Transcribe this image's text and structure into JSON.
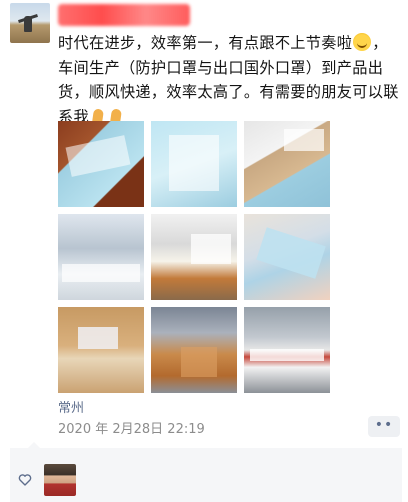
{
  "post": {
    "text_parts": [
      "时代在进步，效率第一，有点跟不上节奏啦",
      "，车间生产（防护口罩与出口国外口罩）到产品出货，顺风快递，效率太高了。有需要的朋友可以联系我"
    ],
    "location": "常州",
    "timestamp": "2020 年 2月28日 22:19",
    "more_label": "••"
  },
  "icons": {
    "like": "heart-outline-icon",
    "emoji_1": "grinning-sweat-emoji",
    "emoji_2": "pray-hands-emoji"
  },
  "colors": {
    "link_blue": "#5d6d8c",
    "meta_gray": "#8c8c8c",
    "likes_bg": "#f5f6f8"
  }
}
